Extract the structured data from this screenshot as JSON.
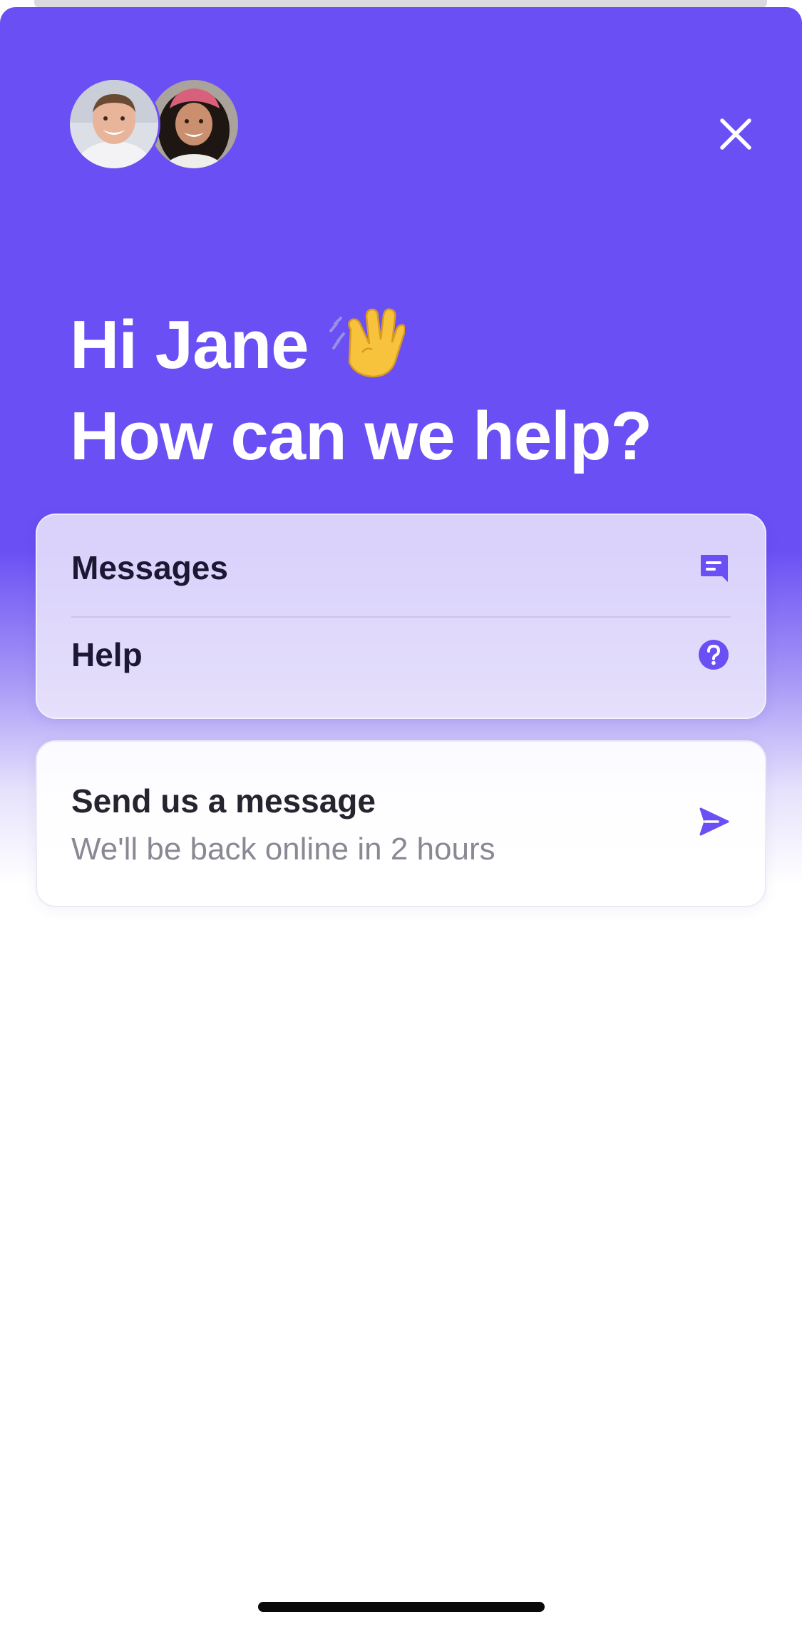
{
  "header": {
    "avatars": [
      {
        "name": "team-member-1"
      },
      {
        "name": "team-member-2"
      }
    ],
    "close_icon": "close-icon"
  },
  "greeting": {
    "line1": "Hi Jane",
    "wave_emoji": "👋",
    "line2": "How can we help?"
  },
  "nav": {
    "items": [
      {
        "label": "Messages",
        "icon": "chat-icon"
      },
      {
        "label": "Help",
        "icon": "question-circle-icon"
      }
    ]
  },
  "send": {
    "title": "Send us a message",
    "subtitle": "We'll be back online in 2 hours",
    "icon": "send-icon"
  },
  "colors": {
    "brand": "#6a4ff4",
    "icon_accent": "#6a4ff4",
    "text_dark": "#1c1733",
    "text_muted": "#8a8893"
  }
}
